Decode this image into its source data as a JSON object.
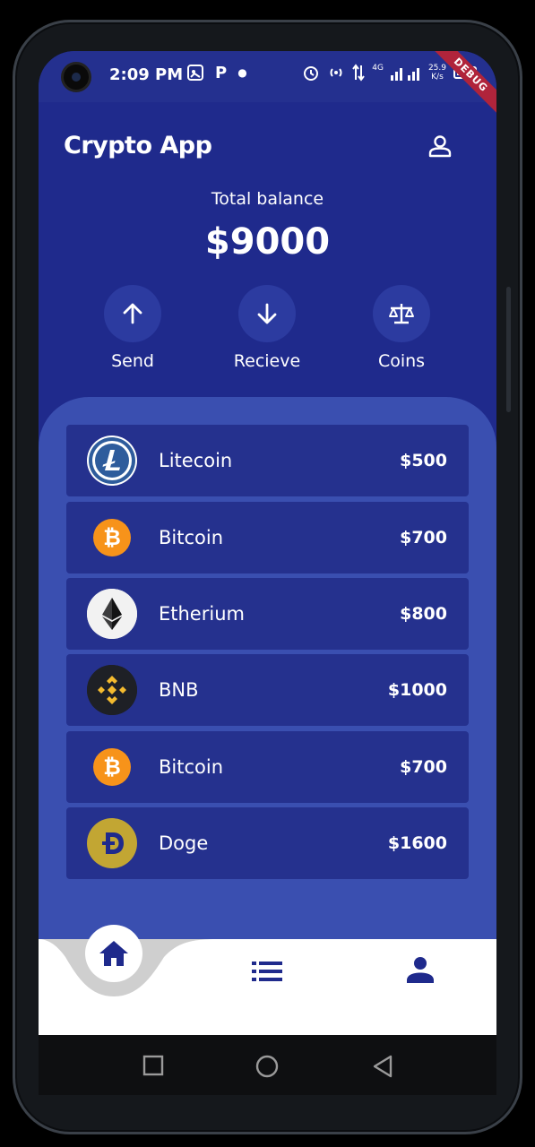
{
  "status_bar": {
    "time": "2:09 PM",
    "notification_letter": "P",
    "network": "4G",
    "speed_value": "25.9",
    "speed_unit": "K/s",
    "debug_banner": "DEBUG"
  },
  "header": {
    "title": "Crypto App",
    "profile_icon": "person-outline-icon"
  },
  "balance": {
    "label": "Total balance",
    "value": "$9000"
  },
  "actions": [
    {
      "label": "Send",
      "icon": "arrow-up-icon"
    },
    {
      "label": "Recieve",
      "icon": "arrow-down-icon"
    },
    {
      "label": "Coins",
      "icon": "scale-icon"
    }
  ],
  "coins": [
    {
      "name": "Litecoin",
      "value": "$500",
      "icon": "litecoin-logo",
      "color": "#2e5c9c"
    },
    {
      "name": "Bitcoin",
      "value": "$700",
      "icon": "bitcoin-logo",
      "color": "#f7931a"
    },
    {
      "name": "Etherium",
      "value": "$800",
      "icon": "ethereum-logo",
      "color": "#3c3c3d"
    },
    {
      "name": "BNB",
      "value": "$1000",
      "icon": "bnb-logo",
      "color": "#f3ba2f"
    },
    {
      "name": "Bitcoin",
      "value": "$700",
      "icon": "bitcoin-logo",
      "color": "#f7931a"
    },
    {
      "name": "Doge",
      "value": "$1600",
      "icon": "doge-logo",
      "color": "#c2a633"
    }
  ],
  "bottom_nav": {
    "items": [
      "home-icon",
      "list-icon",
      "person-icon"
    ],
    "active": "home-icon"
  },
  "colors": {
    "primary": "#1f2a8c",
    "panel": "#3a4fb0",
    "row": "#25318e",
    "nav_icon": "#1f2a8c"
  }
}
